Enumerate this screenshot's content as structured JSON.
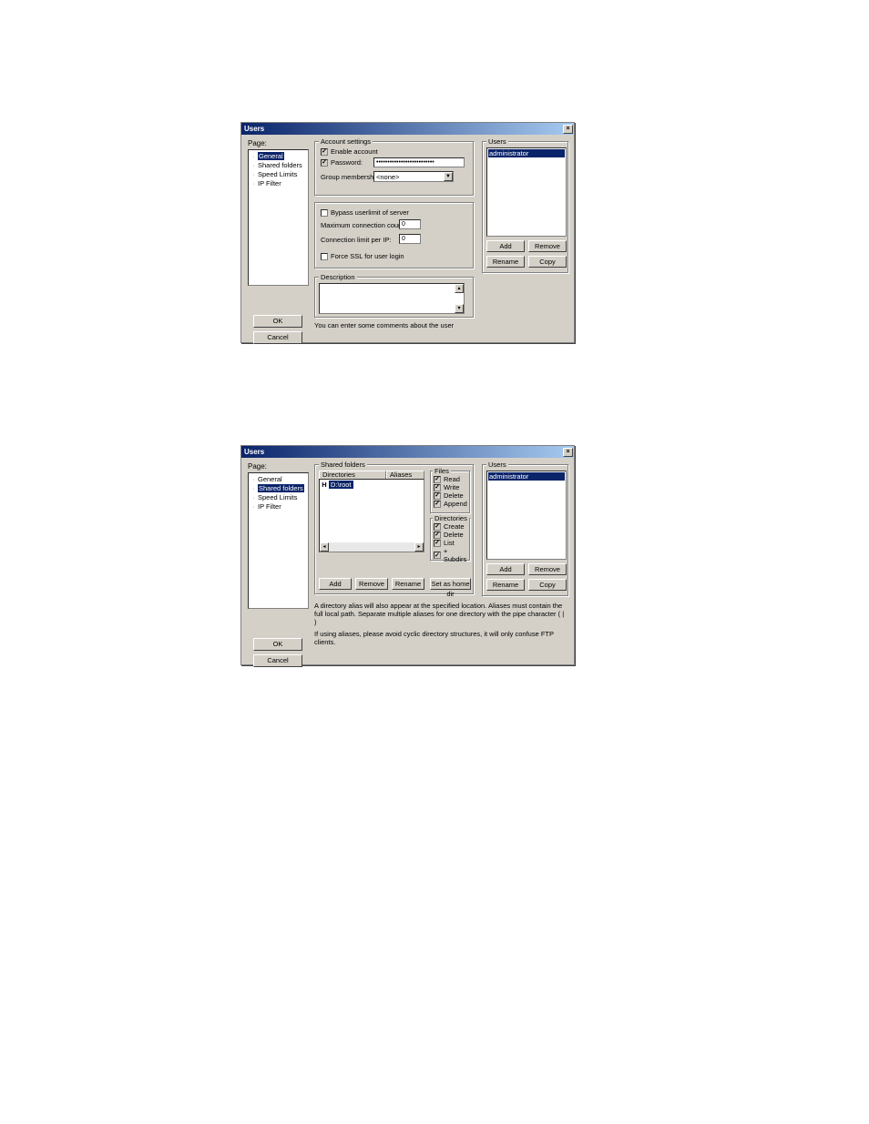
{
  "dialog1": {
    "title": "Users",
    "page_label": "Page:",
    "tree": {
      "items": [
        "General",
        "Shared folders",
        "Speed Limits",
        "IP Filter"
      ],
      "selected": 0
    },
    "ok": "OK",
    "cancel": "Cancel",
    "account": {
      "legend": "Account settings",
      "enable_label": "Enable account",
      "enable_checked": true,
      "password_label": "Password:",
      "password_checked": true,
      "password_value": "••••••••••••••••••••••••••",
      "group_label": "Group membership:",
      "group_value": "<none>"
    },
    "limits": {
      "bypass_label": "Bypass userlimit of server",
      "bypass_checked": false,
      "maxconn_label": "Maximum connection count:",
      "maxconn_value": "0",
      "connip_label": "Connection limit per IP:",
      "connip_value": "0",
      "ssl_label": "Force SSL for user login",
      "ssl_checked": false
    },
    "description": {
      "legend": "Description"
    },
    "hint": "You can enter some comments about the user",
    "users": {
      "legend": "Users",
      "items": [
        "administrator"
      ],
      "add": "Add",
      "remove": "Remove",
      "rename": "Rename",
      "copy": "Copy"
    }
  },
  "dialog2": {
    "title": "Users",
    "page_label": "Page:",
    "tree": {
      "items": [
        "General",
        "Shared folders",
        "Speed Limits",
        "IP Filter"
      ],
      "selected": 1
    },
    "ok": "OK",
    "cancel": "Cancel",
    "shared": {
      "legend": "Shared folders",
      "col_dir": "Directories",
      "col_alias": "Aliases",
      "row_marker": "H",
      "row_path": "D:\\root",
      "add": "Add",
      "remove": "Remove",
      "rename": "Rename",
      "sethome": "Set as home dir"
    },
    "files": {
      "legend": "Files",
      "read": "Read",
      "write": "Write",
      "delete": "Delete",
      "append": "Append"
    },
    "dirs": {
      "legend": "Directories",
      "create": "Create",
      "delete": "Delete",
      "list": "List",
      "subdirs": "+ Subdirs"
    },
    "help1": "A directory alias will also appear at the specified location. Aliases must contain the full local path. Separate multiple aliases for one directory with the pipe character ( | )",
    "help2": "If using aliases, please avoid cyclic directory structures, it will only confuse FTP clients.",
    "users": {
      "legend": "Users",
      "items": [
        "administrator"
      ],
      "add": "Add",
      "remove": "Remove",
      "rename": "Rename",
      "copy": "Copy"
    }
  }
}
